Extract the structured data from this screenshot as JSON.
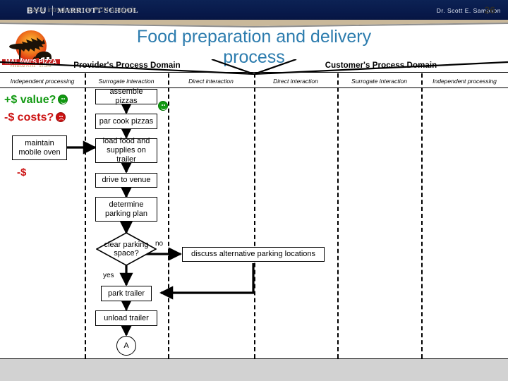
{
  "header": {
    "brand_primary": "BYU",
    "brand_secondary": "MARRIOTT SCHOOL",
    "presenter": "Dr. Scott E. Sampson",
    "bar_color": "#0a2050",
    "swoosh_color": "#c9b89a"
  },
  "logo": {
    "name": "malawis-pizza-logo",
    "wordmark": "MALAWI'S PIZZA",
    "tagline": "PREMIUM PIZZA  ·  GELATO",
    "sun_color": "#E8391E",
    "sky_color": "#F5A623"
  },
  "title": {
    "text": "Food preparation and delivery process",
    "color": "#2C7CAE"
  },
  "domains": [
    {
      "label": "Provider's Process Domain"
    },
    {
      "label": "Customer's Process Domain"
    }
  ],
  "columns": [
    {
      "label": "Independent processing"
    },
    {
      "label": "Surrogate interaction"
    },
    {
      "label": "Direct interaction"
    },
    {
      "label": "Direct interaction"
    },
    {
      "label": "Surrogate interaction"
    },
    {
      "label": "Independent processing"
    }
  ],
  "annotations": {
    "value_text": "+$ value?",
    "value_color": "#119911",
    "costs_text": "-$ costs?",
    "costs_color": "#CC1111",
    "cost_marker": "-$"
  },
  "flow": {
    "nodes": [
      {
        "id": "assemble",
        "label": "assemble pizzas"
      },
      {
        "id": "parcook",
        "label": "par cook pizzas"
      },
      {
        "id": "maintain",
        "label": "maintain mobile oven"
      },
      {
        "id": "load",
        "label": "load food and supplies on trailer"
      },
      {
        "id": "drive",
        "label": "drive to venue"
      },
      {
        "id": "determine",
        "label": "determine parking plan"
      },
      {
        "id": "decision",
        "label": "clear parking space?"
      },
      {
        "id": "discuss",
        "label": "discuss alternative parking locations"
      },
      {
        "id": "park",
        "label": "park trailer"
      },
      {
        "id": "unload",
        "label": "unload trailer"
      },
      {
        "id": "connector",
        "label": "A"
      }
    ],
    "edge_labels": {
      "no": "no",
      "yes": "yes"
    }
  },
  "footer": {
    "text": "Basic introduction to PCN Analysis",
    "page": "26"
  }
}
